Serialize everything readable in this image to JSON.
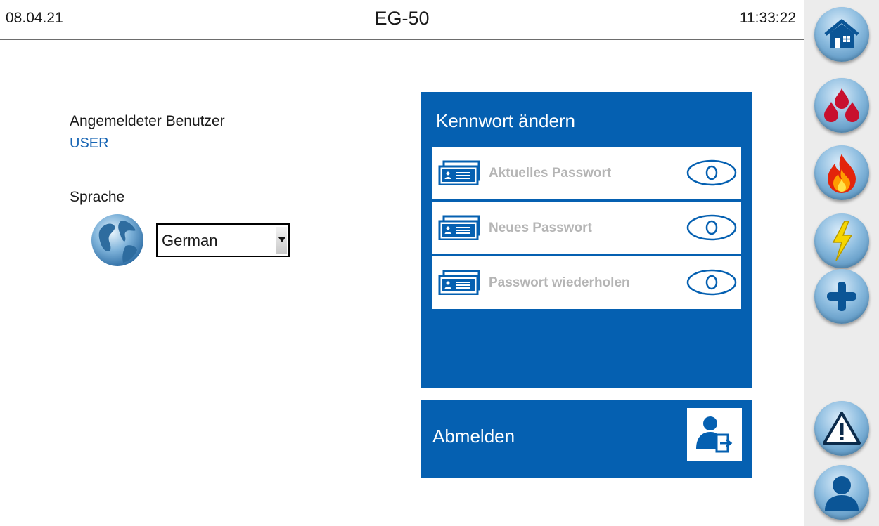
{
  "header": {
    "date": "08.04.21",
    "title": "EG-50",
    "time": "11:33:22"
  },
  "user": {
    "label": "Angemeldeter Benutzer",
    "value": "USER"
  },
  "language": {
    "label": "Sprache",
    "selected": "German"
  },
  "password_panel": {
    "title": "Kennwort ändern",
    "fields": [
      {
        "placeholder": "Aktuelles Passwort"
      },
      {
        "placeholder": "Neues Passwort"
      },
      {
        "placeholder": "Passwort wiederholen"
      }
    ]
  },
  "logout": {
    "label": "Abmelden"
  },
  "sidebar": {
    "buttons": [
      {
        "icon": "home-icon"
      },
      {
        "icon": "gas-drops-icon"
      },
      {
        "icon": "fire-icon"
      },
      {
        "icon": "lightning-icon"
      },
      {
        "icon": "plus-icon"
      },
      {
        "icon": "warning-icon"
      },
      {
        "icon": "user-icon"
      }
    ]
  },
  "colors": {
    "primary_blue": "#0560b1",
    "user_value": "#1765b4",
    "placeholder": "#b5b5b5",
    "sidebar_bg": "#ececec"
  }
}
